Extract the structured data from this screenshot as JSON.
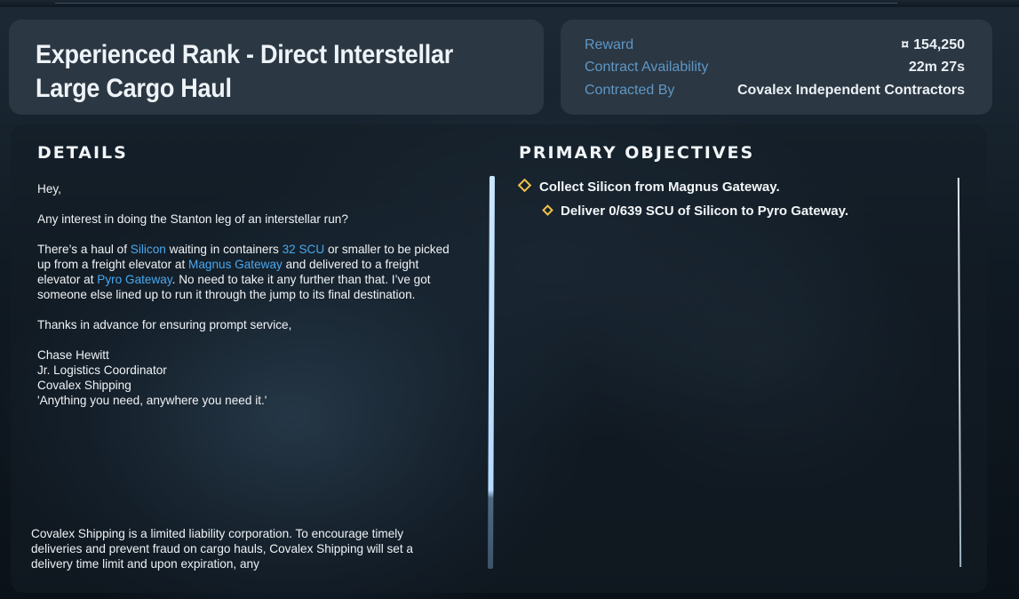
{
  "contract": {
    "title": "Experienced Rank - Direct Interstellar Large Cargo Haul"
  },
  "info": {
    "reward_label": "Reward",
    "reward_icon": "credits-icon",
    "reward_icon_glyph": "¤",
    "reward_value": "154,250",
    "availability_label": "Contract Availability",
    "availability_value": "22m 27s",
    "contracted_by_label": "Contracted By",
    "contracted_by_value": "Covalex Independent Contractors"
  },
  "details": {
    "heading": "DETAILS",
    "greeting": "Hey,",
    "line1": "Any interest in doing the Stanton leg of an interstellar run?",
    "p2_a": "There’s a haul of ",
    "p2_commodity": "Silicon",
    "p2_b": " waiting in containers ",
    "p2_container": "32 SCU",
    "p2_c": " or smaller to be picked up from a freight elevator at ",
    "p2_pickup": "Magnus Gateway",
    "p2_d": " and delivered to a freight elevator at ",
    "p2_dropoff": "Pyro Gateway",
    "p2_e": ". No need to take it any further than that. I’ve got someone else lined up to run it through the jump to its final destination.",
    "thanks": "Thanks in advance for ensuring prompt service,",
    "sig_name": "Chase Hewitt",
    "sig_title": "Jr. Logistics Coordinator",
    "sig_company": "Covalex Shipping",
    "sig_motto": "'Anything you need, anywhere you need it.'",
    "disclaimer": "Covalex Shipping is a limited liability corporation. To encourage timely deliveries and prevent fraud on cargo hauls, Covalex Shipping will set a delivery time limit and upon expiration, any"
  },
  "objectives": {
    "heading": "PRIMARY OBJECTIVES",
    "items": [
      {
        "text": "Collect Silicon from Magnus Gateway."
      },
      {
        "text": "Deliver 0/639 SCU of Silicon to Pyro Gateway."
      }
    ]
  },
  "colors": {
    "accent_link": "#4aa8ee",
    "label_blue": "#5f97c4",
    "objective_marker": "#f0c24a",
    "panel_bg": "#2d3a46"
  }
}
